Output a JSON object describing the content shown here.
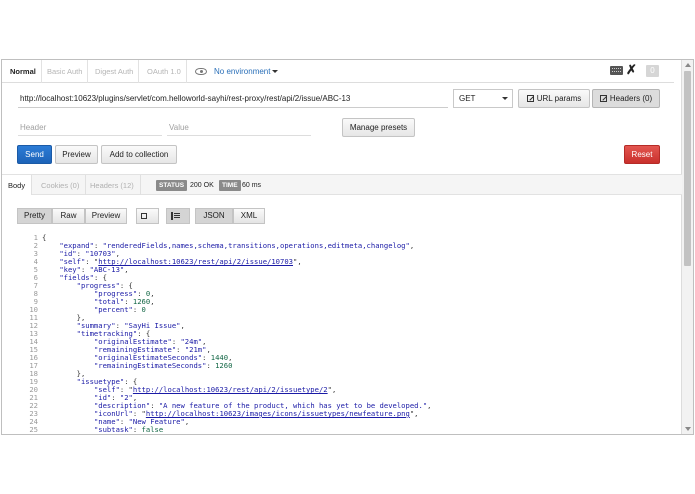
{
  "auth_tabs": [
    "Normal",
    "Basic Auth",
    "Digest Auth",
    "OAuth 1.0"
  ],
  "environment": "No environment",
  "badge_count": "0",
  "request": {
    "url": "http://localhost:10623/plugins/servlet/com.helloworld-sayhi/rest-proxy/rest/api/2/issue/ABC-13",
    "method": "GET",
    "url_params_label": "URL params",
    "headers_label": "Headers (0)"
  },
  "header_row": {
    "header_placeholder": "Header",
    "value_placeholder": "Value",
    "manage_presets_label": "Manage presets"
  },
  "actions": {
    "send": "Send",
    "preview": "Preview",
    "add_to_collection": "Add to collection",
    "reset": "Reset"
  },
  "response_tabs": [
    "Body",
    "Cookies (0)",
    "Headers (12)"
  ],
  "status": {
    "label": "STATUS",
    "value": "200 OK"
  },
  "time": {
    "label": "TIME",
    "value": "60 ms"
  },
  "view_modes": [
    "Pretty",
    "Raw",
    "Preview"
  ],
  "formats": [
    "JSON",
    "XML"
  ],
  "code_lines": [
    [
      {
        "t": "p",
        "v": "{"
      }
    ],
    [
      {
        "t": "p",
        "v": "    "
      },
      {
        "t": "k",
        "v": "\"expand\""
      },
      {
        "t": "p",
        "v": ": "
      },
      {
        "t": "s",
        "v": "\"renderedFields,names,schema,transitions,operations,editmeta,changelog\""
      },
      {
        "t": "p",
        "v": ","
      }
    ],
    [
      {
        "t": "p",
        "v": "    "
      },
      {
        "t": "k",
        "v": "\"id\""
      },
      {
        "t": "p",
        "v": ": "
      },
      {
        "t": "s",
        "v": "\"10703\""
      },
      {
        "t": "p",
        "v": ","
      }
    ],
    [
      {
        "t": "p",
        "v": "    "
      },
      {
        "t": "k",
        "v": "\"self\""
      },
      {
        "t": "p",
        "v": ": \""
      },
      {
        "t": "u",
        "v": "http://localhost:10623/rest/api/2/issue/10703"
      },
      {
        "t": "p",
        "v": "\","
      }
    ],
    [
      {
        "t": "p",
        "v": "    "
      },
      {
        "t": "k",
        "v": "\"key\""
      },
      {
        "t": "p",
        "v": ": "
      },
      {
        "t": "s",
        "v": "\"ABC-13\""
      },
      {
        "t": "p",
        "v": ","
      }
    ],
    [
      {
        "t": "p",
        "v": "    "
      },
      {
        "t": "k",
        "v": "\"fields\""
      },
      {
        "t": "p",
        "v": ": {"
      }
    ],
    [
      {
        "t": "p",
        "v": "        "
      },
      {
        "t": "k",
        "v": "\"progress\""
      },
      {
        "t": "p",
        "v": ": {"
      }
    ],
    [
      {
        "t": "p",
        "v": "            "
      },
      {
        "t": "k",
        "v": "\"progress\""
      },
      {
        "t": "p",
        "v": ": "
      },
      {
        "t": "n",
        "v": "0"
      },
      {
        "t": "p",
        "v": ","
      }
    ],
    [
      {
        "t": "p",
        "v": "            "
      },
      {
        "t": "k",
        "v": "\"total\""
      },
      {
        "t": "p",
        "v": ": "
      },
      {
        "t": "n",
        "v": "1260"
      },
      {
        "t": "p",
        "v": ","
      }
    ],
    [
      {
        "t": "p",
        "v": "            "
      },
      {
        "t": "k",
        "v": "\"percent\""
      },
      {
        "t": "p",
        "v": ": "
      },
      {
        "t": "n",
        "v": "0"
      }
    ],
    [
      {
        "t": "p",
        "v": "        },"
      }
    ],
    [
      {
        "t": "p",
        "v": "        "
      },
      {
        "t": "k",
        "v": "\"summary\""
      },
      {
        "t": "p",
        "v": ": "
      },
      {
        "t": "s",
        "v": "\"SayHi Issue\""
      },
      {
        "t": "p",
        "v": ","
      }
    ],
    [
      {
        "t": "p",
        "v": "        "
      },
      {
        "t": "k",
        "v": "\"timetracking\""
      },
      {
        "t": "p",
        "v": ": {"
      }
    ],
    [
      {
        "t": "p",
        "v": "            "
      },
      {
        "t": "k",
        "v": "\"originalEstimate\""
      },
      {
        "t": "p",
        "v": ": "
      },
      {
        "t": "s",
        "v": "\"24m\""
      },
      {
        "t": "p",
        "v": ","
      }
    ],
    [
      {
        "t": "p",
        "v": "            "
      },
      {
        "t": "k",
        "v": "\"remainingEstimate\""
      },
      {
        "t": "p",
        "v": ": "
      },
      {
        "t": "s",
        "v": "\"21m\""
      },
      {
        "t": "p",
        "v": ","
      }
    ],
    [
      {
        "t": "p",
        "v": "            "
      },
      {
        "t": "k",
        "v": "\"originalEstimateSeconds\""
      },
      {
        "t": "p",
        "v": ": "
      },
      {
        "t": "n",
        "v": "1440"
      },
      {
        "t": "p",
        "v": ","
      }
    ],
    [
      {
        "t": "p",
        "v": "            "
      },
      {
        "t": "k",
        "v": "\"remainingEstimateSeconds\""
      },
      {
        "t": "p",
        "v": ": "
      },
      {
        "t": "n",
        "v": "1260"
      }
    ],
    [
      {
        "t": "p",
        "v": "        },"
      }
    ],
    [
      {
        "t": "p",
        "v": "        "
      },
      {
        "t": "k",
        "v": "\"issuetype\""
      },
      {
        "t": "p",
        "v": ": {"
      }
    ],
    [
      {
        "t": "p",
        "v": "            "
      },
      {
        "t": "k",
        "v": "\"self\""
      },
      {
        "t": "p",
        "v": ": \""
      },
      {
        "t": "u",
        "v": "http://localhost:10623/rest/api/2/issuetype/2"
      },
      {
        "t": "p",
        "v": "\","
      }
    ],
    [
      {
        "t": "p",
        "v": "            "
      },
      {
        "t": "k",
        "v": "\"id\""
      },
      {
        "t": "p",
        "v": ": "
      },
      {
        "t": "s",
        "v": "\"2\""
      },
      {
        "t": "p",
        "v": ","
      }
    ],
    [
      {
        "t": "p",
        "v": "            "
      },
      {
        "t": "k",
        "v": "\"description\""
      },
      {
        "t": "p",
        "v": ": "
      },
      {
        "t": "s",
        "v": "\"A new feature of the product, which has yet to be developed.\""
      },
      {
        "t": "p",
        "v": ","
      }
    ],
    [
      {
        "t": "p",
        "v": "            "
      },
      {
        "t": "k",
        "v": "\"iconUrl\""
      },
      {
        "t": "p",
        "v": ": \""
      },
      {
        "t": "u",
        "v": "http://localhost:10623/images/icons/issuetypes/newfeature.png"
      },
      {
        "t": "p",
        "v": "\","
      }
    ],
    [
      {
        "t": "p",
        "v": "            "
      },
      {
        "t": "k",
        "v": "\"name\""
      },
      {
        "t": "p",
        "v": ": "
      },
      {
        "t": "s",
        "v": "\"New Feature\""
      },
      {
        "t": "p",
        "v": ","
      }
    ],
    [
      {
        "t": "p",
        "v": "            "
      },
      {
        "t": "k",
        "v": "\"subtask\""
      },
      {
        "t": "p",
        "v": ": "
      },
      {
        "t": "n",
        "v": "false"
      }
    ]
  ]
}
